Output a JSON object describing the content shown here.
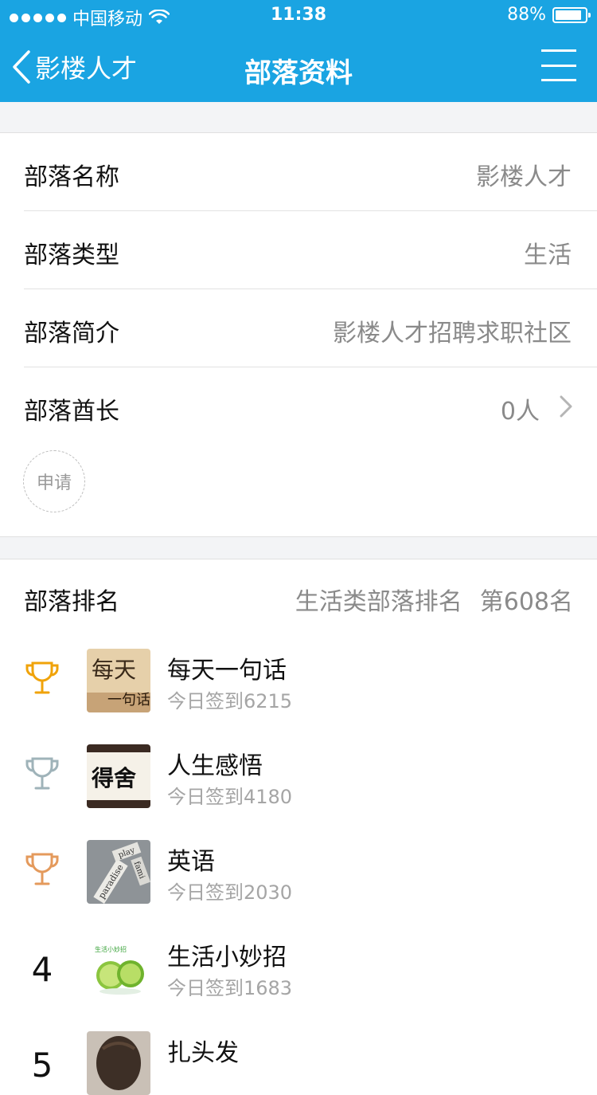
{
  "status_bar": {
    "carrier": "中国移动",
    "time": "11:38",
    "battery": "88%",
    "battery_level": 0.88
  },
  "nav": {
    "back_label": "影楼人才",
    "title": "部落资料"
  },
  "info_rows": [
    {
      "label": "部落名称",
      "value": "影楼人才"
    },
    {
      "label": "部落类型",
      "value": "生活"
    },
    {
      "label": "部落简介",
      "value": "影楼人才招聘求职社区"
    },
    {
      "label": "部落酋长",
      "value": "0人"
    }
  ],
  "apply_label": "申请",
  "ranking": {
    "label": "部落排名",
    "category": "生活类部落排名",
    "position": "第608名"
  },
  "ranking_list": [
    {
      "rank": 1,
      "icon": "trophy-gold-icon",
      "color": "#f0a30a",
      "title": "每天一句话",
      "subtitle": "今日签到6215"
    },
    {
      "rank": 2,
      "icon": "trophy-silver-icon",
      "color": "#9fb3b9",
      "title": "人生感悟",
      "subtitle": "今日签到4180"
    },
    {
      "rank": 3,
      "icon": "trophy-bronze-icon",
      "color": "#e49a5c",
      "title": "英语",
      "subtitle": "今日签到2030"
    },
    {
      "rank_label": "4",
      "title": "生活小妙招",
      "subtitle": "今日签到1683"
    },
    {
      "rank_label": "5",
      "title": "扎头发",
      "subtitle": ""
    }
  ],
  "thumbnails": {
    "item1_text_a": "每天",
    "item1_text_b": "一句话",
    "item2_text": "得舍",
    "item3_text_a": "paradise",
    "item3_text_b": "play",
    "item3_text_c": "fami",
    "item4_text": "生活小妙招"
  },
  "colors": {
    "nav_blue": "#1aa4e2",
    "divider_bg": "#f3f4f6",
    "secondary_text": "#8a8a8a"
  }
}
